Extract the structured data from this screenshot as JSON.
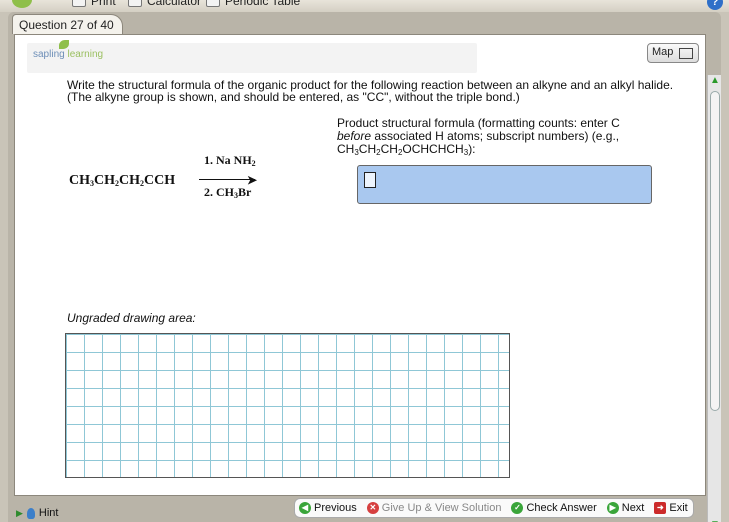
{
  "toolbar": {
    "print_label": "Print",
    "calculator_label": "Calculator",
    "periodic_table_label": "Periodic Table",
    "help_symbol": "?"
  },
  "question_tab": "Question 27 of 40",
  "branding": {
    "word1": "sapling",
    "word2": "learning"
  },
  "map_button": "Map",
  "question_text": "Write the structural formula of the organic product for the following reaction between an alkyne and an alkyl halide. (The alkyne group is shown, and should be entered, as \"CC\", without the triple bond.)",
  "reaction": {
    "reactant": [
      "CH",
      "3",
      "CH",
      "2",
      "CH",
      "2",
      "CCH"
    ],
    "reagent1": [
      "1. Na NH",
      "2"
    ],
    "reagent2": [
      "2. CH",
      "3",
      "Br"
    ]
  },
  "prompt": {
    "line1": "Product structural formula (formatting counts: enter C",
    "line2_italic": "before",
    "line2_rest": " associated H atoms; subscript numbers) (e.g.,",
    "line3": [
      "CH",
      "3",
      "CH",
      "2",
      "CH",
      "2",
      "OCHCHCH",
      "3",
      "):"
    ]
  },
  "answer_value": "",
  "drawing_area_label": "Ungraded drawing area:",
  "hint_label": "Hint",
  "nav": {
    "previous": "Previous",
    "give_up": "Give Up & View Solution",
    "check": "Check Answer",
    "next": "Next",
    "exit": "Exit"
  },
  "colors": {
    "answer_box": "#a9c8ef",
    "grid_lines": "#8fc7d6",
    "nav_green": "#3aa53a"
  }
}
